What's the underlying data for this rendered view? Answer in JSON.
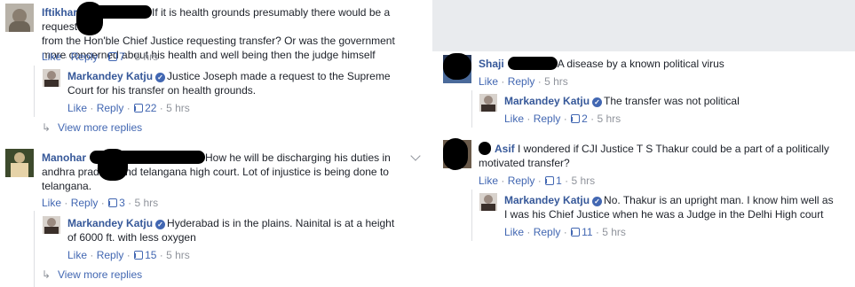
{
  "left": {
    "c1": {
      "name": "Iftikhar",
      "text_l1": "If it is health grounds presumably there would be a request",
      "text_l2": "from the Hon'ble Chief Justice requesting transfer? Or was the government",
      "text_l3": "more concerned about his health and well being then the judge himself",
      "like": "Like",
      "reply": "Reply",
      "likes": "7",
      "time": "5 hrs",
      "reply1": {
        "name": "Markandey Katju",
        "text_l1": "Justice Joseph made a request to the Supreme",
        "text_l2": "Court for his transfer on health grounds.",
        "like": "Like",
        "reply": "Reply",
        "likes": "22",
        "time": "5 hrs"
      },
      "view_more": "View more replies"
    },
    "c2": {
      "name": "Manohar",
      "text_l1": "How he will be discharging his duties in",
      "text_l2": "andhra pradesh and telangana high court. Lot of injustice is being done to",
      "text_l3": "telangana.",
      "like": "Like",
      "reply": "Reply",
      "likes": "3",
      "time": "5 hrs",
      "reply1": {
        "name": "Markandey Katju",
        "text_l1": "Hyderabad is in the plains. Nainital is at a height",
        "text_l2": "of 6000 ft. with less oxygen",
        "like": "Like",
        "reply": "Reply",
        "likes": "15",
        "time": "5 hrs"
      },
      "view_more": "View more replies"
    }
  },
  "right": {
    "c1": {
      "name": "Shaji",
      "text_l1": "A disease by a known political virus",
      "like": "Like",
      "reply": "Reply",
      "time": "5 hrs",
      "reply1": {
        "name": "Markandey Katju",
        "text_l1": "The transfer was not political",
        "like": "Like",
        "reply": "Reply",
        "likes": "2",
        "time": "5 hrs"
      }
    },
    "c2": {
      "name": "Asif",
      "text_l1": "I wondered if CJI Justice T S Thakur could be a part of a politically",
      "text_l2": "motivated transfer?",
      "like": "Like",
      "reply": "Reply",
      "likes": "1",
      "time": "5 hrs",
      "reply1": {
        "name": "Markandey Katju",
        "text_l1": "No. Thakur is an upright man. I know him well as",
        "text_l2": "I was his Chief Justice when he was a Judge in the Delhi High court",
        "like": "Like",
        "reply": "Reply",
        "likes": "11",
        "time": "5 hrs"
      }
    }
  },
  "sep": "·",
  "colors": {
    "link": "#4267b2",
    "name": "#365899",
    "meta": "#90949c",
    "background": "#e9ebee"
  }
}
